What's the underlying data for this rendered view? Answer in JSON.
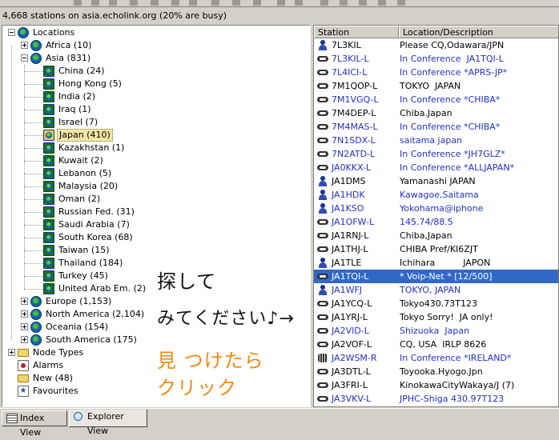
{
  "status_text": "4,668 stations on asia.echolink.org (20% are busy)",
  "tree": [
    {
      "label": "Locations",
      "level": 0,
      "expander": "minus",
      "icon": "globe"
    },
    {
      "label": "Africa (10)",
      "level": 1,
      "expander": "plus",
      "icon": "globe"
    },
    {
      "label": "Asia (831)",
      "level": 1,
      "expander": "minus",
      "icon": "globe"
    },
    {
      "label": "China (24)",
      "level": 2,
      "icon": "inner-globe"
    },
    {
      "label": "Hong Kong (5)",
      "level": 2,
      "icon": "inner-globe"
    },
    {
      "label": "India (2)",
      "level": 2,
      "icon": "inner-globe"
    },
    {
      "label": "Iraq (1)",
      "level": 2,
      "icon": "inner-globe"
    },
    {
      "label": "Israel (7)",
      "level": 2,
      "icon": "inner-globe"
    },
    {
      "label": "Japan (410)",
      "level": 2,
      "icon": "yellow-globe",
      "selected": true
    },
    {
      "label": "Kazakhstan (1)",
      "level": 2,
      "icon": "inner-globe"
    },
    {
      "label": "Kuwait (2)",
      "level": 2,
      "icon": "inner-globe"
    },
    {
      "label": "Lebanon (5)",
      "level": 2,
      "icon": "inner-globe"
    },
    {
      "label": "Malaysia (20)",
      "level": 2,
      "icon": "inner-globe"
    },
    {
      "label": "Oman (2)",
      "level": 2,
      "icon": "inner-globe"
    },
    {
      "label": "Russian Fed. (31)",
      "level": 2,
      "icon": "inner-globe"
    },
    {
      "label": "Saudi Arabia (7)",
      "level": 2,
      "icon": "inner-globe"
    },
    {
      "label": "South Korea (68)",
      "level": 2,
      "icon": "inner-globe"
    },
    {
      "label": "Taiwan (15)",
      "level": 2,
      "icon": "inner-globe"
    },
    {
      "label": "Thailand (184)",
      "level": 2,
      "icon": "inner-globe"
    },
    {
      "label": "Turkey (45)",
      "level": 2,
      "icon": "inner-globe"
    },
    {
      "label": "United Arab Em. (2)",
      "level": 2,
      "icon": "inner-globe"
    },
    {
      "label": "Europe (1,153)",
      "level": 1,
      "expander": "plus",
      "icon": "globe"
    },
    {
      "label": "North America (2,104)",
      "level": 1,
      "expander": "plus",
      "icon": "globe"
    },
    {
      "label": "Oceania (154)",
      "level": 1,
      "expander": "plus",
      "icon": "globe"
    },
    {
      "label": "South America (175)",
      "level": 1,
      "expander": "plus",
      "icon": "globe"
    },
    {
      "label": "Node Types",
      "level": 0,
      "expander": "plus",
      "icon": "folder"
    },
    {
      "label": "Alarms",
      "level": 0,
      "icon": "alarm"
    },
    {
      "label": "New (48)",
      "level": 0,
      "icon": "folder"
    },
    {
      "label": "Favourites",
      "level": 0,
      "icon": "star"
    }
  ],
  "columns": {
    "station": "Station",
    "location": "Location/Description"
  },
  "stations": [
    {
      "call": "7L3KIL",
      "desc": "Please CQ,Odawara/JPN",
      "icon": "user",
      "call_color": "black",
      "desc_color": "black"
    },
    {
      "call": "7L3KIL-L",
      "desc": "In Conference  JA1TQI-L",
      "icon": "link",
      "call_color": "blue",
      "desc_color": "blue"
    },
    {
      "call": "7L4ICI-L",
      "desc": "In Conference *APRS-JP*",
      "icon": "link",
      "call_color": "blue",
      "desc_color": "blue"
    },
    {
      "call": "7M1QOP-L",
      "desc": "TOKYO  JAPAN",
      "icon": "link",
      "call_color": "black",
      "desc_color": "black"
    },
    {
      "call": "7M1VGQ-L",
      "desc": "In Conference *CHIBA*",
      "icon": "link",
      "call_color": "blue",
      "desc_color": "blue"
    },
    {
      "call": "7M4DEP-L",
      "desc": "Chiba.Japan",
      "icon": "link",
      "call_color": "black",
      "desc_color": "black"
    },
    {
      "call": "7M4MAS-L",
      "desc": "In Conference *CHIBA*",
      "icon": "link",
      "call_color": "blue",
      "desc_color": "blue"
    },
    {
      "call": "7N1SDX-L",
      "desc": "saitama japan",
      "icon": "link",
      "call_color": "blue",
      "desc_color": "blue"
    },
    {
      "call": "7N2ATD-L",
      "desc": "In Conference *JH7GLZ*",
      "icon": "link",
      "call_color": "blue",
      "desc_color": "blue"
    },
    {
      "call": "JA0KKX-L",
      "desc": "In Conference *ALLJAPAN*",
      "icon": "link",
      "call_color": "blue",
      "desc_color": "blue"
    },
    {
      "call": "JA1DMS",
      "desc": "Yamanashi JAPAN",
      "icon": "user",
      "call_color": "black",
      "desc_color": "black"
    },
    {
      "call": "JA1HDK",
      "desc": "Kawagoe,Saitama",
      "icon": "user",
      "call_color": "blue",
      "desc_color": "blue"
    },
    {
      "call": "JA1KSO",
      "desc": "Yokohama@iphone",
      "icon": "user",
      "call_color": "blue",
      "desc_color": "blue"
    },
    {
      "call": "JA1OFW-L",
      "desc": "145.74/88.5",
      "icon": "link",
      "call_color": "blue",
      "desc_color": "blue"
    },
    {
      "call": "JA1RNJ-L",
      "desc": "Chiba,Japan",
      "icon": "link",
      "call_color": "black",
      "desc_color": "black"
    },
    {
      "call": "JA1THJ-L",
      "desc": "CHIBA Pref/KI6ZJT",
      "icon": "link",
      "call_color": "black",
      "desc_color": "black"
    },
    {
      "call": "JA1TLE",
      "desc": "Ichihara          JAPON",
      "icon": "user",
      "call_color": "black",
      "desc_color": "black"
    },
    {
      "call": "JA1TQI-L",
      "desc": "* Voip-Net * [12/500]",
      "icon": "link",
      "call_color": "blue",
      "desc_color": "blue",
      "selected": true
    },
    {
      "call": "JA1WFJ",
      "desc": "TOKYO, JAPAN",
      "icon": "user",
      "call_color": "blue",
      "desc_color": "blue"
    },
    {
      "call": "JA1YCQ-L",
      "desc": "Tokyo430.73T123",
      "icon": "link",
      "call_color": "black",
      "desc_color": "black"
    },
    {
      "call": "JA1YRJ-L",
      "desc": "Tokyo Sorry!  JA only!",
      "icon": "link",
      "call_color": "black",
      "desc_color": "black"
    },
    {
      "call": "JA2VID-L",
      "desc": "Shizuoka  Japan",
      "icon": "link",
      "call_color": "blue",
      "desc_color": "blue"
    },
    {
      "call": "JA2VOF-L",
      "desc": "CQ, USA  IRLP 8626",
      "icon": "link",
      "call_color": "black",
      "desc_color": "black"
    },
    {
      "call": "JA2WSM-R",
      "desc": "In Conference *IRELAND*",
      "icon": "group",
      "call_color": "blue",
      "desc_color": "blue"
    },
    {
      "call": "JA3DTL-L",
      "desc": "Toyooka.Hyogo.Jpn",
      "icon": "link",
      "call_color": "black",
      "desc_color": "black"
    },
    {
      "call": "JA3FRI-L",
      "desc": "KinokawaCityWakaya/J (7)",
      "icon": "link",
      "call_color": "black",
      "desc_color": "black"
    },
    {
      "call": "JA3VKV-L",
      "desc": "JPHC-Shiga 430.97T123",
      "icon": "link",
      "call_color": "blue",
      "desc_color": "blue"
    }
  ],
  "annotation": {
    "line1": "探して",
    "line2": "みてください♪→",
    "line3": "見 つけたら",
    "line4": "クリック"
  },
  "tabs": [
    {
      "label": "Index View",
      "icon": "grid-icon",
      "active": false
    },
    {
      "label": "Explorer View",
      "icon": "magnifier-icon",
      "active": true
    }
  ],
  "colors": {
    "selection": "#3168c6",
    "link_blue": "#2030c8",
    "annotation_orange": "#f08a10"
  }
}
